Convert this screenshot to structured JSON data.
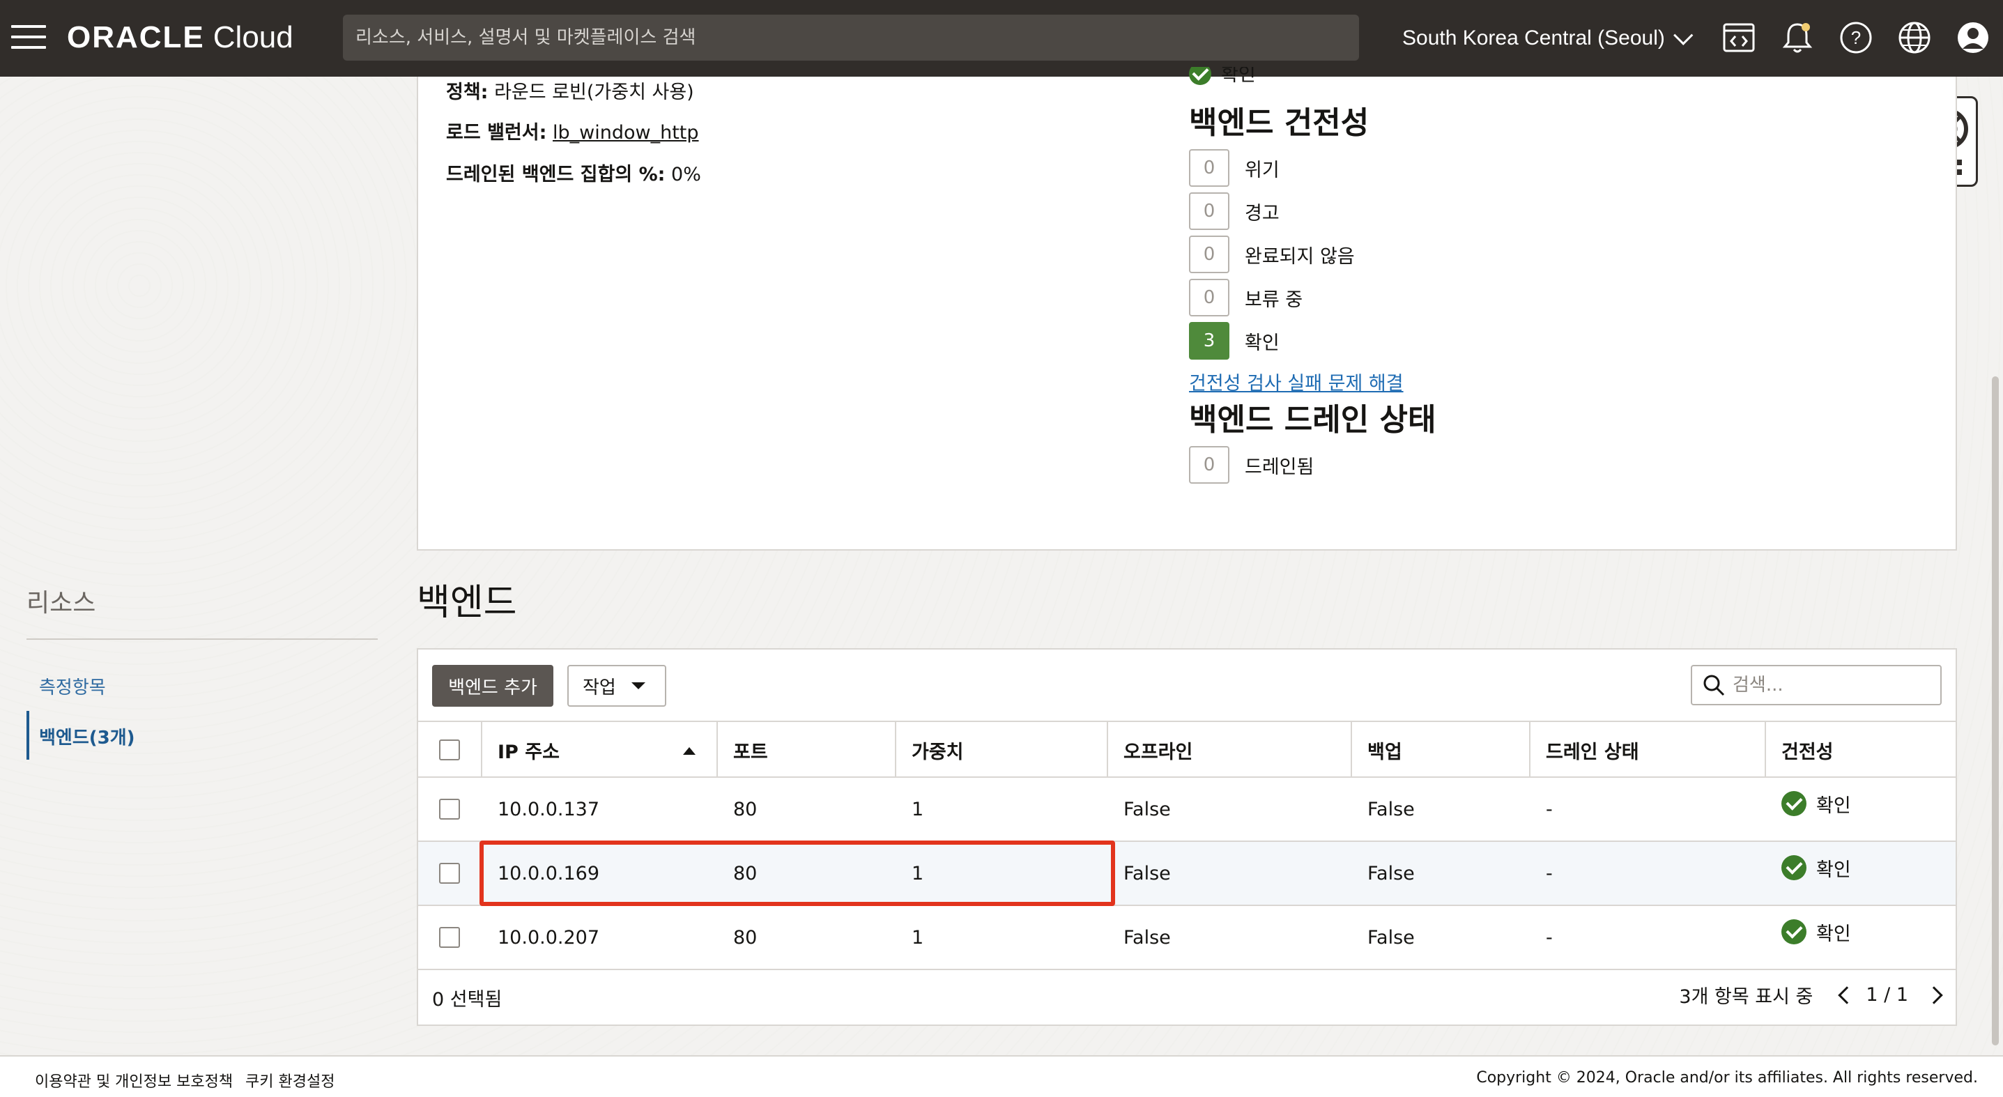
{
  "topbar": {
    "logo_brand": "ORACLE",
    "logo_product": "Cloud",
    "search_placeholder": "리소스, 서비스, 설명서 및 마켓플레이스 검색",
    "region": "South Korea Central (Seoul)",
    "icons": [
      "hamburger-menu-icon",
      "code-editor-icon",
      "bell-icon",
      "help-icon",
      "globe-icon",
      "user-avatar-icon"
    ]
  },
  "details": {
    "top_partial_status": "확인",
    "policy_label": "정책:",
    "policy_value": "라운드 로빈(가중치 사용)",
    "lb_label": "로드 밸런서:",
    "lb_value": "lb_window_http",
    "drain_label": "드레인된 백엔드 집합의 %:",
    "drain_value": "0%"
  },
  "health": {
    "title": "백엔드 건전성",
    "rows": [
      {
        "count": "0",
        "label": "위기"
      },
      {
        "count": "0",
        "label": "경고"
      },
      {
        "count": "0",
        "label": "완료되지 않음"
      },
      {
        "count": "0",
        "label": "보류 중"
      },
      {
        "count": "3",
        "label": "확인"
      }
    ],
    "troubleshoot_link": "건전성 검사 실패 문제 해결"
  },
  "drain": {
    "title": "백엔드 드레인 상태",
    "count": "0",
    "label": "드레인됨"
  },
  "resources": {
    "title": "리소스",
    "items": [
      {
        "label": "측정항목"
      },
      {
        "label": "백엔드(3개)"
      }
    ]
  },
  "backends": {
    "title": "백엔드",
    "add_button": "백엔드 추가",
    "action_button": "작업",
    "search_placeholder": "검색...",
    "columns": [
      "IP 주소",
      "포트",
      "가중치",
      "오프라인",
      "백업",
      "드레인 상태",
      "건전성"
    ],
    "rows": [
      {
        "ip": "10.0.0.137",
        "port": "80",
        "weight": "1",
        "offline": "False",
        "backup": "False",
        "drain": "-",
        "health": "확인"
      },
      {
        "ip": "10.0.0.169",
        "port": "80",
        "weight": "1",
        "offline": "False",
        "backup": "False",
        "drain": "-",
        "health": "확인"
      },
      {
        "ip": "10.0.0.207",
        "port": "80",
        "weight": "1",
        "offline": "False",
        "backup": "False",
        "drain": "-",
        "health": "확인"
      }
    ],
    "selected": "0 선택됨",
    "showing": "3개 항목 표시 중",
    "page": "1 / 1"
  },
  "footer": {
    "terms": "이용약관 및 개인정보 보호정책",
    "cookies": "쿠키 환경설정",
    "copyright": "Copyright © 2024, Oracle and/or its affiliates. All rights reserved."
  },
  "colors": {
    "topbar": "#312d2a",
    "accent_link": "#1f6cb3",
    "ok_green": "#4f8a3b",
    "highlight_red": "#e2341d"
  }
}
